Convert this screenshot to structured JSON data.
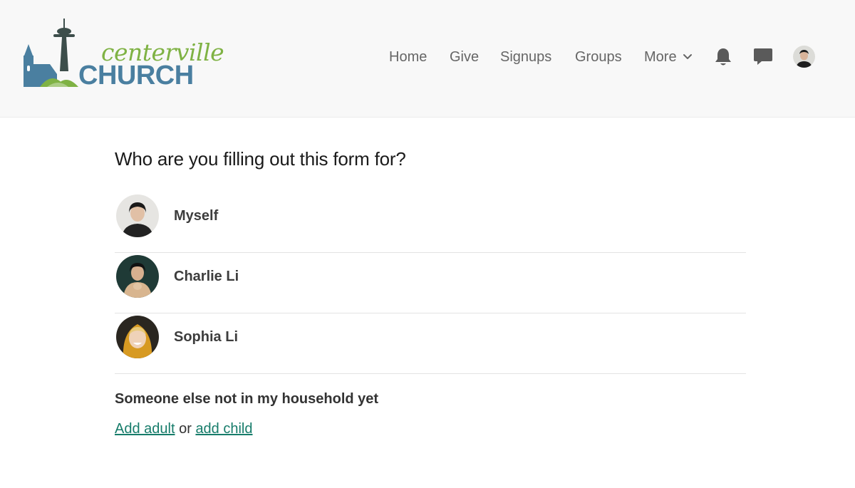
{
  "brand": {
    "logo_top": "centerville",
    "logo_bottom": "CHURCH",
    "colors": {
      "green": "#7fb244",
      "blue": "#4a7fa0",
      "dark": "#3d4e4b"
    }
  },
  "nav": {
    "items": [
      {
        "label": "Home"
      },
      {
        "label": "Give"
      },
      {
        "label": "Signups"
      },
      {
        "label": "Groups"
      },
      {
        "label": "More"
      }
    ],
    "icons": [
      "bell-icon",
      "chat-icon",
      "avatar"
    ]
  },
  "main": {
    "title": "Who are you filling out this form for?",
    "people": [
      {
        "name": "Myself"
      },
      {
        "name": "Charlie Li"
      },
      {
        "name": "Sophia Li"
      }
    ],
    "other_heading": "Someone else not in my household yet",
    "add_adult": "Add adult",
    "or_text": "or",
    "add_child": "add child"
  },
  "colors": {
    "link": "#167c6a",
    "divider": "#e3e3e3",
    "header_bg": "#f8f8f8"
  }
}
